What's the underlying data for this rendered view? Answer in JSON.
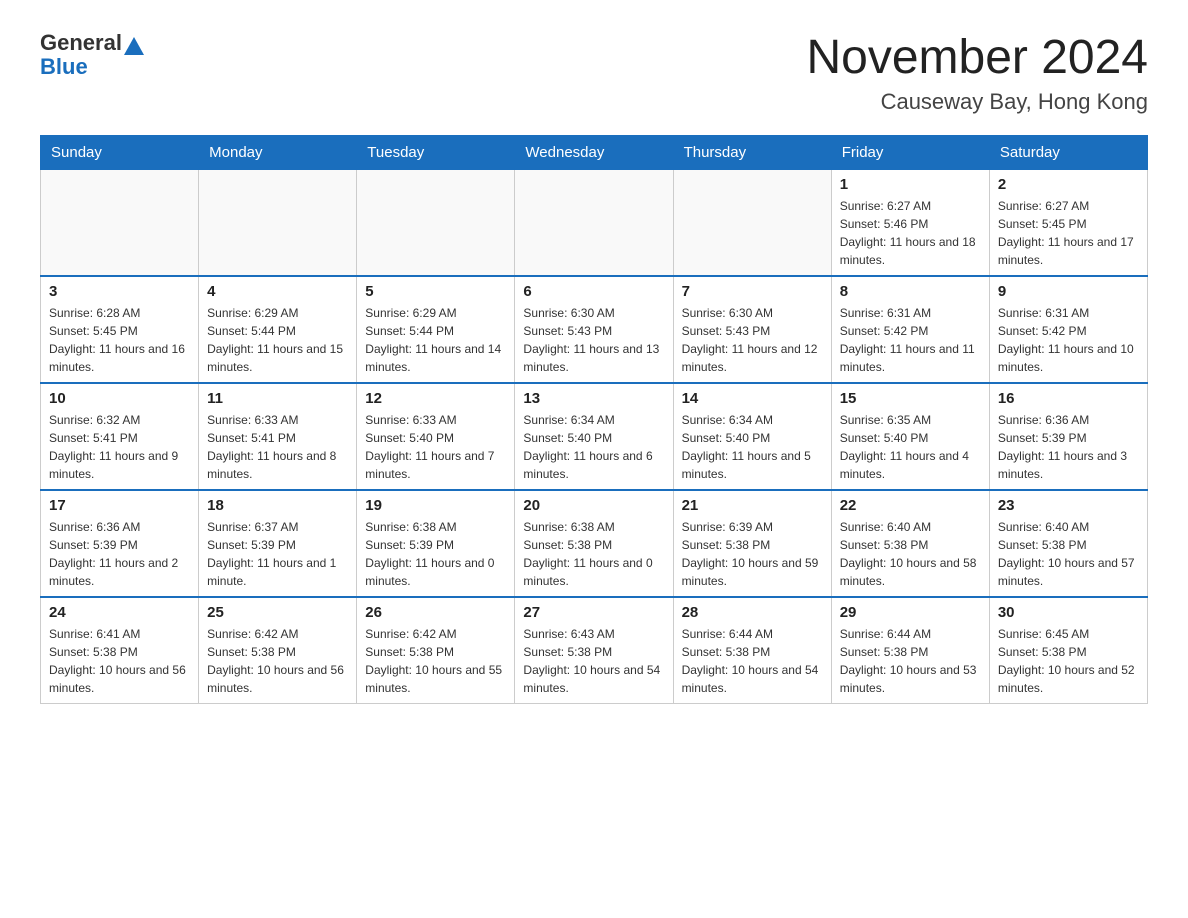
{
  "logo": {
    "text_general": "General",
    "text_blue": "Blue"
  },
  "header": {
    "title": "November 2024",
    "subtitle": "Causeway Bay, Hong Kong"
  },
  "weekdays": [
    "Sunday",
    "Monday",
    "Tuesday",
    "Wednesday",
    "Thursday",
    "Friday",
    "Saturday"
  ],
  "weeks": [
    [
      {
        "day": "",
        "info": ""
      },
      {
        "day": "",
        "info": ""
      },
      {
        "day": "",
        "info": ""
      },
      {
        "day": "",
        "info": ""
      },
      {
        "day": "",
        "info": ""
      },
      {
        "day": "1",
        "info": "Sunrise: 6:27 AM\nSunset: 5:46 PM\nDaylight: 11 hours and 18 minutes."
      },
      {
        "day": "2",
        "info": "Sunrise: 6:27 AM\nSunset: 5:45 PM\nDaylight: 11 hours and 17 minutes."
      }
    ],
    [
      {
        "day": "3",
        "info": "Sunrise: 6:28 AM\nSunset: 5:45 PM\nDaylight: 11 hours and 16 minutes."
      },
      {
        "day": "4",
        "info": "Sunrise: 6:29 AM\nSunset: 5:44 PM\nDaylight: 11 hours and 15 minutes."
      },
      {
        "day": "5",
        "info": "Sunrise: 6:29 AM\nSunset: 5:44 PM\nDaylight: 11 hours and 14 minutes."
      },
      {
        "day": "6",
        "info": "Sunrise: 6:30 AM\nSunset: 5:43 PM\nDaylight: 11 hours and 13 minutes."
      },
      {
        "day": "7",
        "info": "Sunrise: 6:30 AM\nSunset: 5:43 PM\nDaylight: 11 hours and 12 minutes."
      },
      {
        "day": "8",
        "info": "Sunrise: 6:31 AM\nSunset: 5:42 PM\nDaylight: 11 hours and 11 minutes."
      },
      {
        "day": "9",
        "info": "Sunrise: 6:31 AM\nSunset: 5:42 PM\nDaylight: 11 hours and 10 minutes."
      }
    ],
    [
      {
        "day": "10",
        "info": "Sunrise: 6:32 AM\nSunset: 5:41 PM\nDaylight: 11 hours and 9 minutes."
      },
      {
        "day": "11",
        "info": "Sunrise: 6:33 AM\nSunset: 5:41 PM\nDaylight: 11 hours and 8 minutes."
      },
      {
        "day": "12",
        "info": "Sunrise: 6:33 AM\nSunset: 5:40 PM\nDaylight: 11 hours and 7 minutes."
      },
      {
        "day": "13",
        "info": "Sunrise: 6:34 AM\nSunset: 5:40 PM\nDaylight: 11 hours and 6 minutes."
      },
      {
        "day": "14",
        "info": "Sunrise: 6:34 AM\nSunset: 5:40 PM\nDaylight: 11 hours and 5 minutes."
      },
      {
        "day": "15",
        "info": "Sunrise: 6:35 AM\nSunset: 5:40 PM\nDaylight: 11 hours and 4 minutes."
      },
      {
        "day": "16",
        "info": "Sunrise: 6:36 AM\nSunset: 5:39 PM\nDaylight: 11 hours and 3 minutes."
      }
    ],
    [
      {
        "day": "17",
        "info": "Sunrise: 6:36 AM\nSunset: 5:39 PM\nDaylight: 11 hours and 2 minutes."
      },
      {
        "day": "18",
        "info": "Sunrise: 6:37 AM\nSunset: 5:39 PM\nDaylight: 11 hours and 1 minute."
      },
      {
        "day": "19",
        "info": "Sunrise: 6:38 AM\nSunset: 5:39 PM\nDaylight: 11 hours and 0 minutes."
      },
      {
        "day": "20",
        "info": "Sunrise: 6:38 AM\nSunset: 5:38 PM\nDaylight: 11 hours and 0 minutes."
      },
      {
        "day": "21",
        "info": "Sunrise: 6:39 AM\nSunset: 5:38 PM\nDaylight: 10 hours and 59 minutes."
      },
      {
        "day": "22",
        "info": "Sunrise: 6:40 AM\nSunset: 5:38 PM\nDaylight: 10 hours and 58 minutes."
      },
      {
        "day": "23",
        "info": "Sunrise: 6:40 AM\nSunset: 5:38 PM\nDaylight: 10 hours and 57 minutes."
      }
    ],
    [
      {
        "day": "24",
        "info": "Sunrise: 6:41 AM\nSunset: 5:38 PM\nDaylight: 10 hours and 56 minutes."
      },
      {
        "day": "25",
        "info": "Sunrise: 6:42 AM\nSunset: 5:38 PM\nDaylight: 10 hours and 56 minutes."
      },
      {
        "day": "26",
        "info": "Sunrise: 6:42 AM\nSunset: 5:38 PM\nDaylight: 10 hours and 55 minutes."
      },
      {
        "day": "27",
        "info": "Sunrise: 6:43 AM\nSunset: 5:38 PM\nDaylight: 10 hours and 54 minutes."
      },
      {
        "day": "28",
        "info": "Sunrise: 6:44 AM\nSunset: 5:38 PM\nDaylight: 10 hours and 54 minutes."
      },
      {
        "day": "29",
        "info": "Sunrise: 6:44 AM\nSunset: 5:38 PM\nDaylight: 10 hours and 53 minutes."
      },
      {
        "day": "30",
        "info": "Sunrise: 6:45 AM\nSunset: 5:38 PM\nDaylight: 10 hours and 52 minutes."
      }
    ]
  ]
}
